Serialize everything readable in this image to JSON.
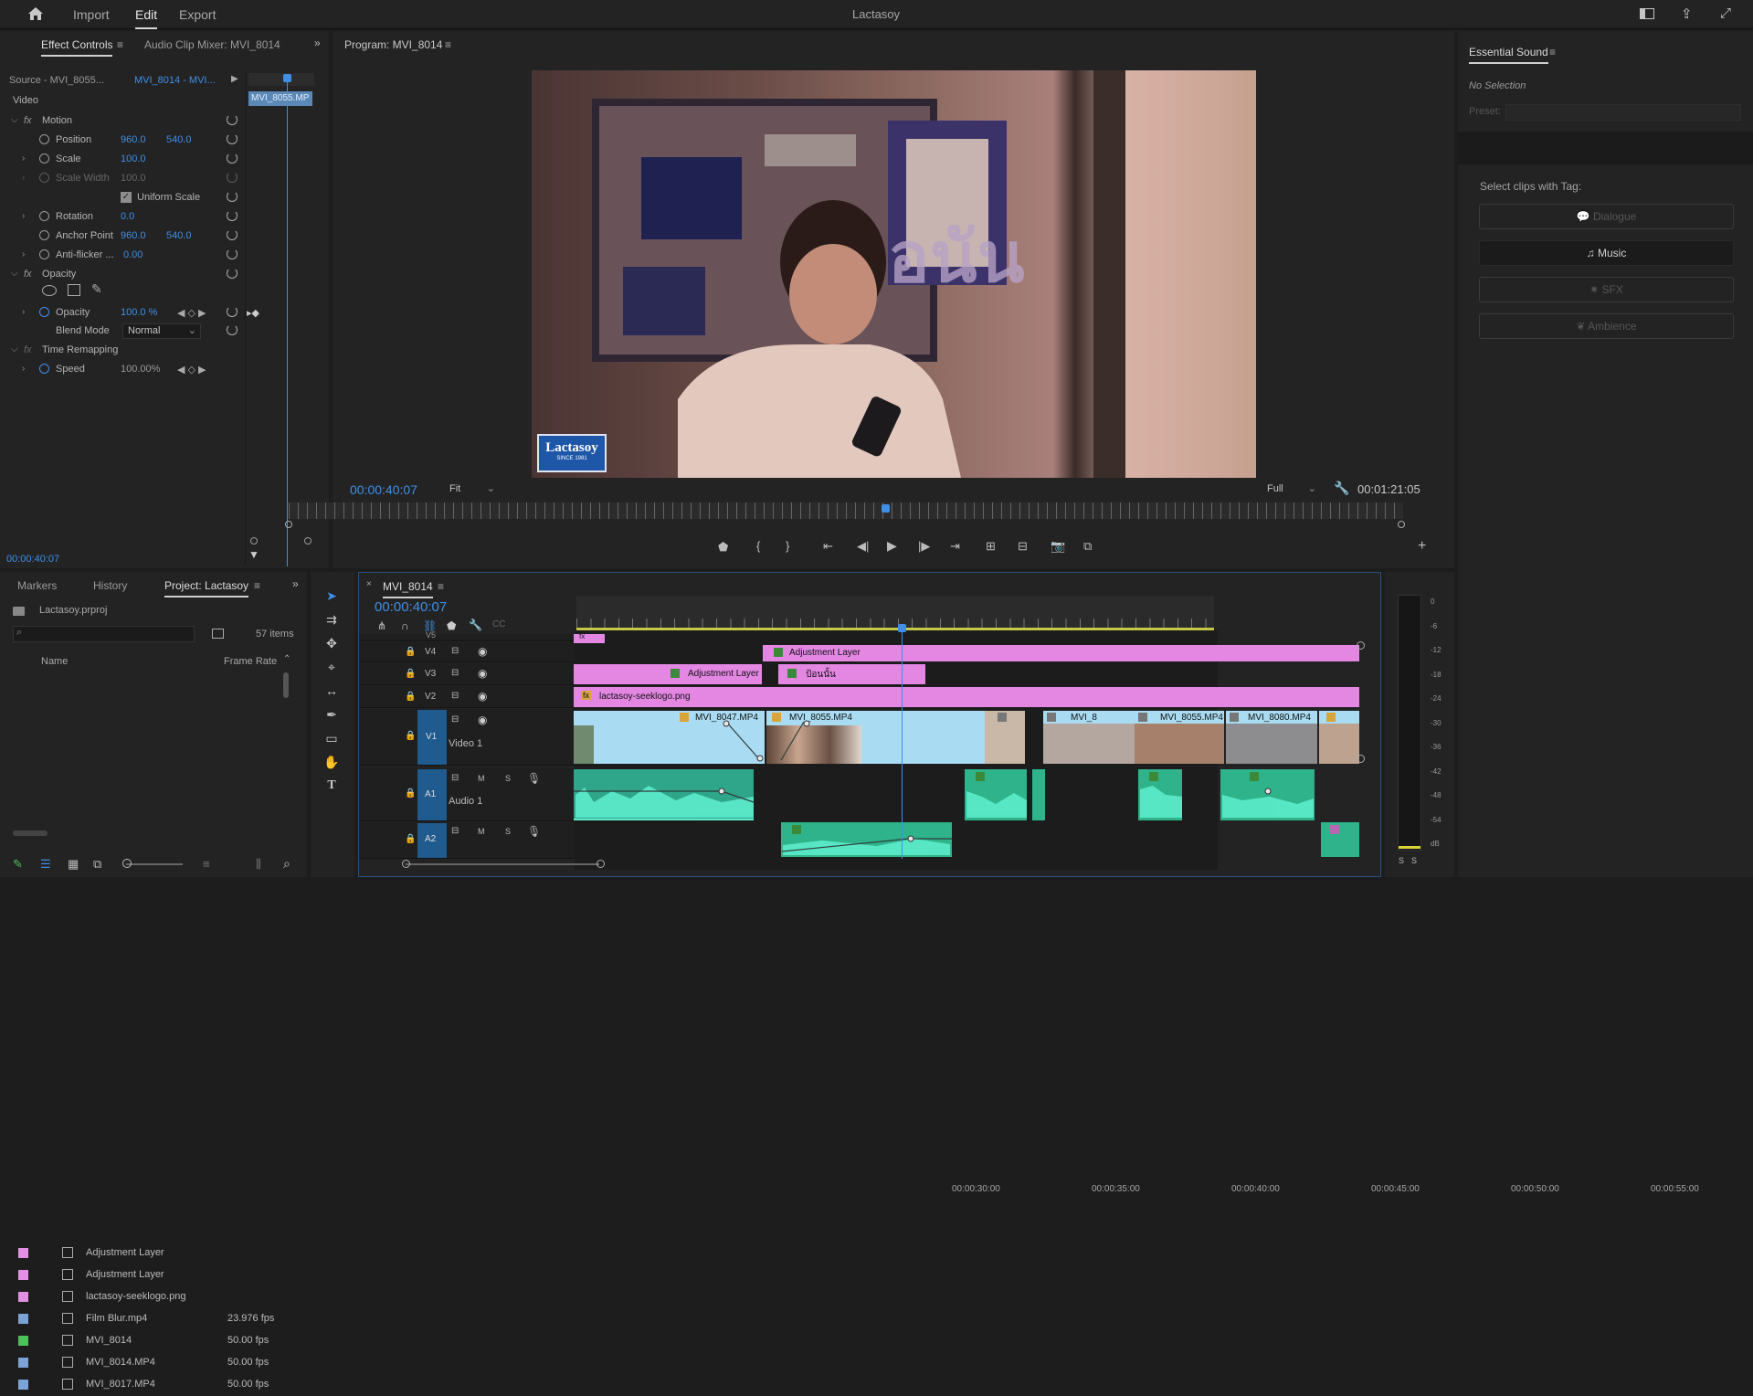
{
  "app": {
    "title": "Lactasoy",
    "nav": [
      "Import",
      "Edit",
      "Export"
    ],
    "active_nav": "Edit"
  },
  "effect_controls": {
    "tabs": [
      "Effect Controls",
      "Audio Clip Mixer: MVI_8014"
    ],
    "source": "Source - MVI_8055...",
    "sequence_clip": "MVI_8014 - MVI...",
    "mini_clip": "MVI_8055.MP",
    "video_label": "Video",
    "motion": "Motion",
    "rows": [
      {
        "label": "Position",
        "v1": "960.0",
        "v2": "540.0"
      },
      {
        "label": "Scale",
        "v1": "100.0"
      },
      {
        "label": "Scale Width",
        "v1": "100.0"
      },
      {
        "label": "Uniform Scale"
      },
      {
        "label": "Rotation",
        "v1": "0.0"
      },
      {
        "label": "Anchor Point",
        "v1": "960.0",
        "v2": "540.0"
      },
      {
        "label": "Anti-flicker ...",
        "v1": "0.00"
      }
    ],
    "opacity_section": "Opacity",
    "opacity_label": "Opacity",
    "opacity_value": "100.0 %",
    "blend_label": "Blend Mode",
    "blend_value": "Normal",
    "time_remap": "Time Remapping",
    "speed_label": "Speed",
    "speed_value": "100.00%",
    "timecode": "00:00:40:07"
  },
  "program": {
    "title": "Program: MVI_8014",
    "timecode": "00:00:40:07",
    "fit": "Fit",
    "quality": "Full",
    "duration": "00:01:21:05",
    "overlay_text": "อนัน",
    "logo_text": "Lactasoy",
    "logo_sub": "SINCE 1981"
  },
  "essential_sound": {
    "title": "Essential Sound",
    "no_selection": "No Selection",
    "preset_label": "Preset:",
    "select_tag": "Select clips with Tag:",
    "buttons": [
      "Dialogue",
      "Music",
      "SFX",
      "Ambience"
    ]
  },
  "project": {
    "tabs": [
      "Markers",
      "History",
      "Project: Lactasoy"
    ],
    "file": "Lactasoy.prproj",
    "items_count": "57 items",
    "col_name": "Name",
    "col_fps": "Frame Rate",
    "items": [
      {
        "name": "Adjustment Layer",
        "fps": "",
        "color": "#e38fe3"
      },
      {
        "name": "Adjustment Layer",
        "fps": "",
        "color": "#e38fe3"
      },
      {
        "name": "lactasoy-seeklogo.png",
        "fps": "",
        "color": "#e38fe3"
      },
      {
        "name": "Film Blur.mp4",
        "fps": "23.976 fps",
        "color": "#7ba3d8"
      },
      {
        "name": "MVI_8014",
        "fps": "50.00 fps",
        "color": "#4fbf5a"
      },
      {
        "name": "MVI_8014.MP4",
        "fps": "50.00 fps",
        "color": "#7ba3d8"
      },
      {
        "name": "MVI_8017.MP4",
        "fps": "50.00 fps",
        "color": "#7ba3d8"
      }
    ]
  },
  "timeline": {
    "sequence": "MVI_8014",
    "timecode": "00:00:40:07",
    "ruler": [
      "00:00:30:00",
      "00:00:35:00",
      "00:00:40:00",
      "00:00:45:00",
      "00:00:50:00",
      "00:00:55:00"
    ],
    "tracks": {
      "v5": "V5",
      "v4": "V4",
      "v3": "V3",
      "v2": "V2",
      "v1": "V1",
      "v1_name": "Video 1",
      "a1": "A1",
      "a1_name": "Audio 1",
      "a2": "A2"
    },
    "clips": {
      "adj1": "Adjustment Layer",
      "adj2": "Adjustment Layer",
      "thai": "ป้อนนั้น",
      "logo": "lactasoy-seeklogo.png",
      "v1a": "MVI_8047.MP4",
      "v1b": "MVI_8055.MP4",
      "v1c": "MVI_8",
      "v1d": "MVI_8055.MP4",
      "v1e": "MVI_8080.MP4"
    },
    "fx": "fx",
    "mute": "M",
    "solo": "S"
  },
  "meter": {
    "scale": [
      "0",
      "-6",
      "-12",
      "-18",
      "-24",
      "-30",
      "-36",
      "-42",
      "-48",
      "-54",
      "dB"
    ],
    "solo": [
      "S",
      "S"
    ]
  }
}
